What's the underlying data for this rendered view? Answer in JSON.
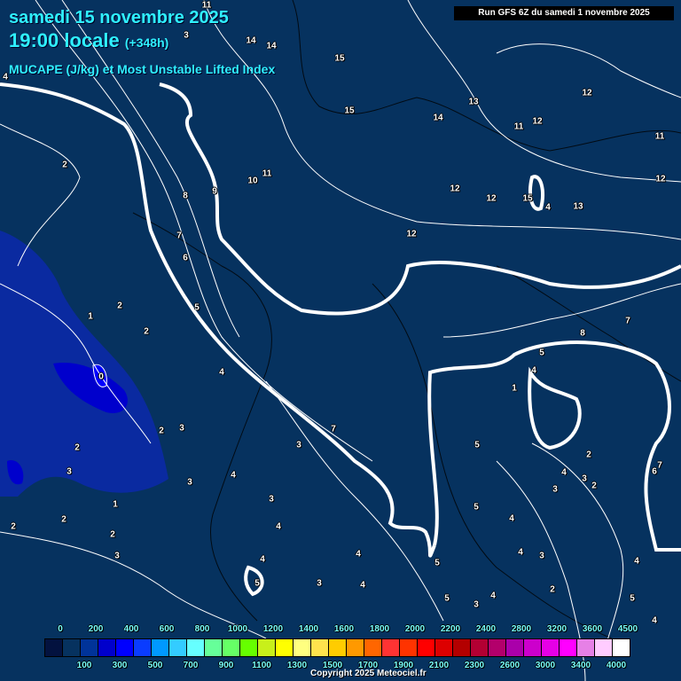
{
  "header": {
    "date": "samedi 15 novembre 2025",
    "time": "19:00 locale",
    "lead": "(+348h)",
    "parameter_title": "MUCAPE (J/kg) et Most Unstable Lifted Index",
    "run_info": "Run GFS 6Z du samedi 1 novembre 2025"
  },
  "map": {
    "background_color": "#06325f",
    "lifted_index_labels": [
      "11",
      "3",
      "14",
      "14",
      "15",
      "4",
      "15",
      "14",
      "13",
      "12",
      "11",
      "12",
      "11",
      "12",
      "2",
      "11",
      "10",
      "9",
      "8",
      "12",
      "12",
      "15",
      "4",
      "13",
      "7",
      "6",
      "12",
      "2",
      "1",
      "5",
      "2",
      "7",
      "8",
      "5",
      "4",
      "4",
      "0",
      "1",
      "2",
      "3",
      "2",
      "3",
      "7",
      "5",
      "2",
      "4",
      "3",
      "2",
      "7",
      "6",
      "3",
      "3",
      "4",
      "3",
      "1",
      "3",
      "5",
      "4",
      "2",
      "2",
      "4",
      "2",
      "3",
      "4",
      "4",
      "4",
      "3",
      "4",
      "5",
      "3",
      "4",
      "5",
      "2",
      "5",
      "3",
      "4",
      "5",
      "4"
    ]
  },
  "legend": {
    "colors": [
      "#03123f",
      "#06325f",
      "#003399",
      "#0000cc",
      "#0000ff",
      "#0a3cff",
      "#0099ff",
      "#33ccff",
      "#66ffff",
      "#66ff99",
      "#66ff66",
      "#66ff00",
      "#c8f01a",
      "#ffff00",
      "#ffff80",
      "#ffe34d",
      "#ffcc00",
      "#ff9900",
      "#ff6600",
      "#ff3333",
      "#ff3300",
      "#ff0000",
      "#dd0000",
      "#b30000",
      "#b30033",
      "#b3006b",
      "#aa00aa",
      "#cc00cc",
      "#e600e6",
      "#ff00ff",
      "#e680e6",
      "#ffccff",
      "#ffffff"
    ],
    "top_labels": [
      "0",
      "200",
      "400",
      "600",
      "800",
      "1000",
      "1200",
      "1400",
      "1600",
      "1800",
      "2000",
      "2200",
      "2400",
      "2800",
      "3200",
      "3600",
      "4500"
    ],
    "bottom_labels": [
      "100",
      "300",
      "500",
      "700",
      "900",
      "1100",
      "1300",
      "1500",
      "1700",
      "1900",
      "2100",
      "2300",
      "2600",
      "3000",
      "3400",
      "4000"
    ]
  },
  "footer": {
    "copyright": "Copyright 2025 Meteociel.fr"
  }
}
